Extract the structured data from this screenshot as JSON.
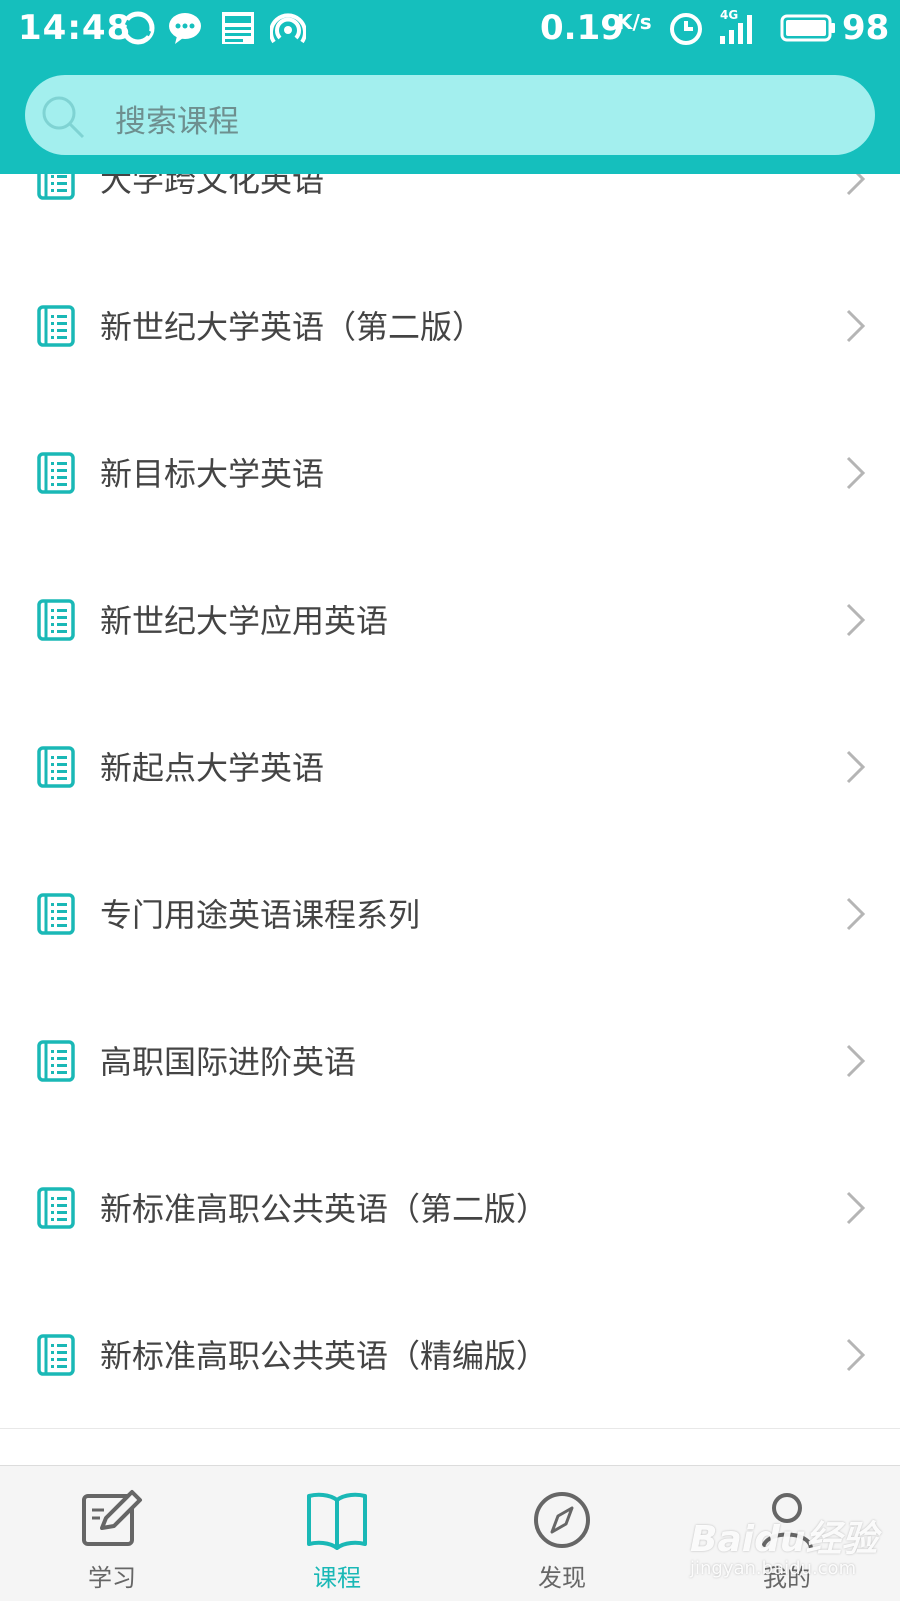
{
  "status_bar": {
    "time": "14:48",
    "net_speed": "0.19",
    "net_unit": "K/s",
    "signal": "4G",
    "battery": "98",
    "icons": [
      "sync-icon",
      "chat-icon",
      "news-icon",
      "hotspot-icon",
      "alarm-icon",
      "signal-icon",
      "battery-icon"
    ]
  },
  "search": {
    "placeholder": "搜索课程"
  },
  "courses": [
    {
      "label": "大学跨文化英语"
    },
    {
      "label": "新世纪大学英语（第二版）"
    },
    {
      "label": "新目标大学英语"
    },
    {
      "label": "新世纪大学应用英语"
    },
    {
      "label": "新起点大学英语"
    },
    {
      "label": "专门用途英语课程系列"
    },
    {
      "label": "高职国际进阶英语"
    },
    {
      "label": "新标准高职公共英语（第二版）"
    },
    {
      "label": "新标准高职公共英语（精编版）"
    }
  ],
  "bottom_nav": [
    {
      "label": "学习",
      "icon": "edit-icon",
      "active": false
    },
    {
      "label": "课程",
      "icon": "book-icon",
      "active": true
    },
    {
      "label": "发现",
      "icon": "compass-icon",
      "active": false
    },
    {
      "label": "我的",
      "icon": "user-icon",
      "active": false
    }
  ],
  "watermark": {
    "main": "Baidu经验",
    "sub": "jingyan.baidu.com"
  },
  "colors": {
    "header": "#15bfbd",
    "search_bg": "#a3efee",
    "accent": "#1ab8b6"
  }
}
